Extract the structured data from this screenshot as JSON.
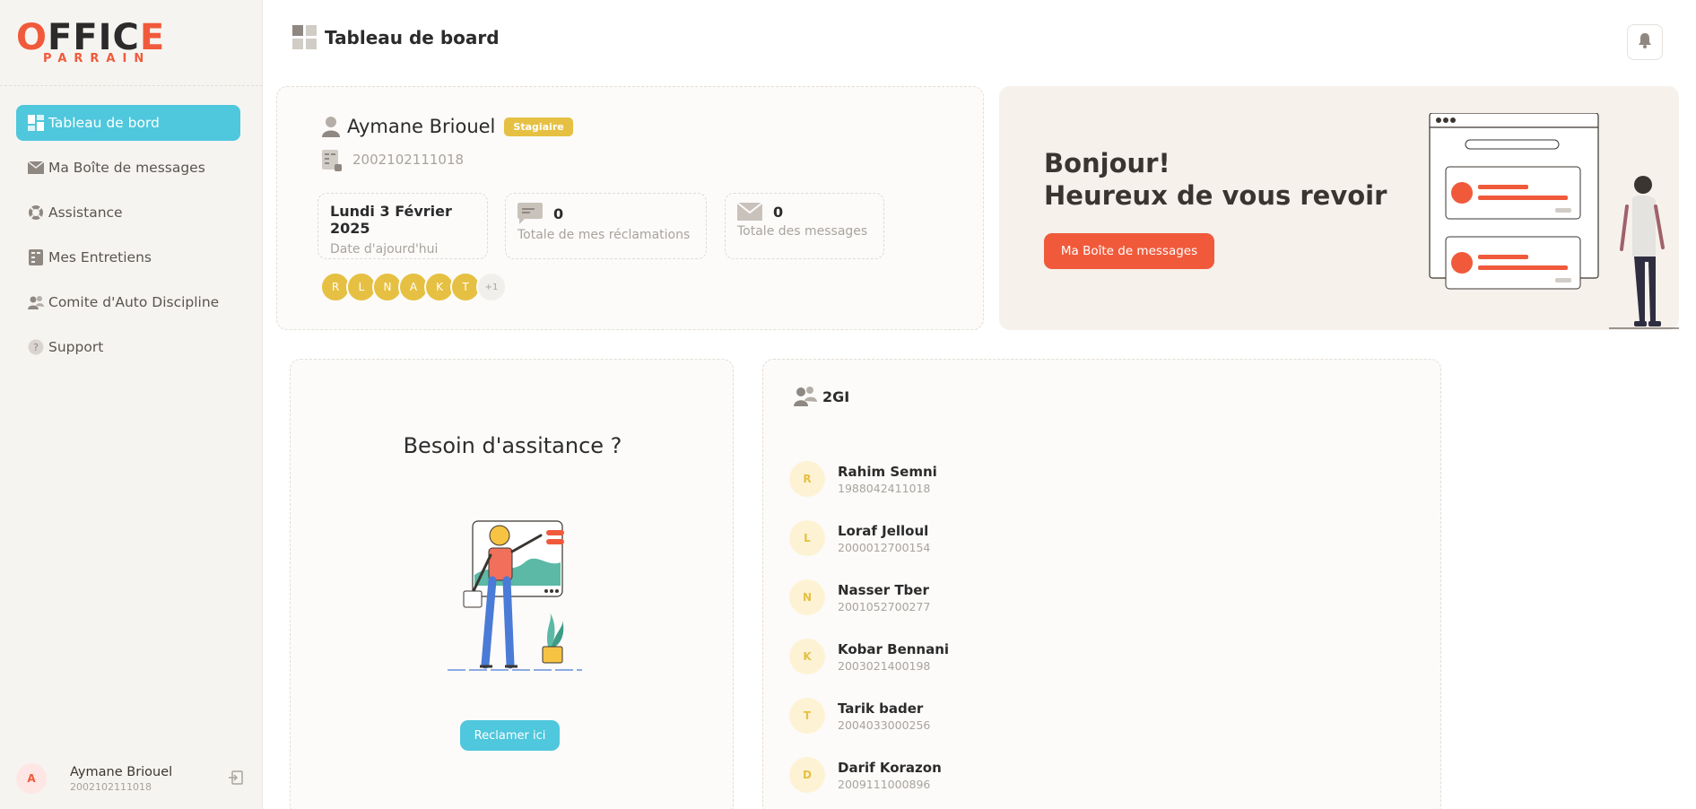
{
  "brand": {
    "logo_top": "OFFICE",
    "logo_sub": "PARRAIN",
    "accent": "#f05a3b",
    "primary": "#4fc7dc",
    "yellow": "#e6c042"
  },
  "sidebar": {
    "items": [
      {
        "label": "Tableau de bord",
        "icon": "dashboard-icon",
        "active": true
      },
      {
        "label": "Ma Boîte de messages",
        "icon": "envelope-icon"
      },
      {
        "label": "Assistance",
        "icon": "lifebuoy-icon"
      },
      {
        "label": "Mes Entretiens",
        "icon": "notebook-icon"
      },
      {
        "label": "Comite d'Auto Discipline",
        "icon": "users-icon"
      },
      {
        "label": "Support",
        "icon": "question-icon"
      }
    ],
    "user": {
      "initial": "A",
      "name": "Aymane Briouel",
      "id": "2002102111018"
    }
  },
  "header": {
    "title": "Tableau de board"
  },
  "profile": {
    "name": "Aymane Briouel",
    "role_badge": "Stagiaire",
    "id": "2002102111018",
    "date": "Lundi 3 Février 2025",
    "date_label": "Date d'ajourd'hui",
    "reclamations_count": "0",
    "reclamations_label": "Totale de mes réclamations",
    "messages_count": "0",
    "messages_label": "Totale des messages",
    "group_initials": [
      "R",
      "L",
      "N",
      "A",
      "K",
      "T"
    ],
    "group_more": "+1"
  },
  "welcome": {
    "line1": "Bonjour!",
    "line2": "Heureux de vous revoir",
    "button": "Ma Boîte de messages"
  },
  "assistance": {
    "title": "Besoin d'assitance ?",
    "button": "Reclamer ici"
  },
  "group": {
    "name": "2GI",
    "members": [
      {
        "initial": "R",
        "name": "Rahim Semni",
        "id": "1988042411018"
      },
      {
        "initial": "L",
        "name": "Loraf Jelloul",
        "id": "2000012700154"
      },
      {
        "initial": "N",
        "name": "Nasser Tber",
        "id": "2001052700277"
      },
      {
        "initial": "K",
        "name": "Kobar Bennani",
        "id": "2003021400198"
      },
      {
        "initial": "T",
        "name": "Tarik bader",
        "id": "2004033000256"
      },
      {
        "initial": "D",
        "name": "Darif Korazon",
        "id": "2009111000896"
      }
    ]
  }
}
